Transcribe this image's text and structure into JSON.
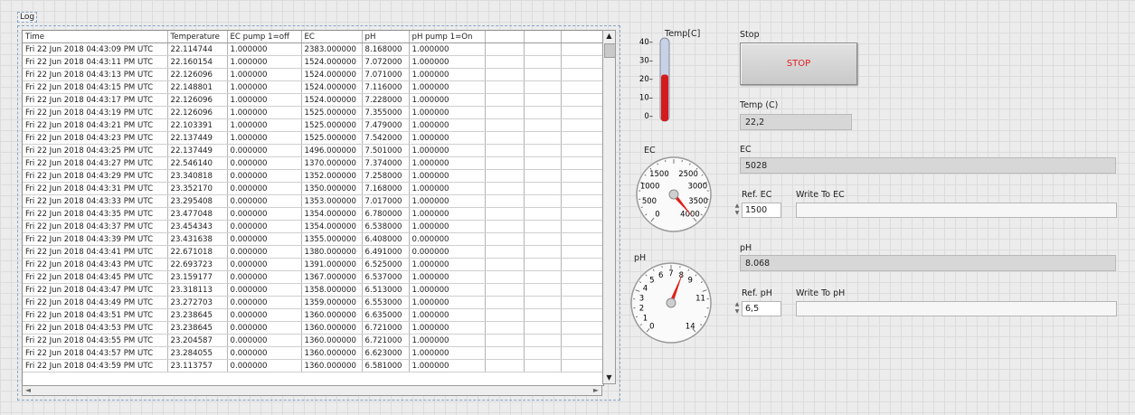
{
  "log": {
    "label": "Log",
    "columns": [
      "Time",
      "Temperature",
      "EC pump 1=off",
      "EC",
      "pH",
      "pH pump 1=On",
      "",
      "",
      ""
    ],
    "rows": [
      [
        "Fri 22 Jun 2018 04:43:09 PM UTC",
        "22.114744",
        "1.000000",
        "2383.000000",
        "8.168000",
        "1.000000"
      ],
      [
        "Fri 22 Jun 2018 04:43:11 PM UTC",
        "22.160154",
        "1.000000",
        "1524.000000",
        "7.072000",
        "1.000000"
      ],
      [
        "Fri 22 Jun 2018 04:43:13 PM UTC",
        "22.126096",
        "1.000000",
        "1524.000000",
        "7.071000",
        "1.000000"
      ],
      [
        "Fri 22 Jun 2018 04:43:15 PM UTC",
        "22.148801",
        "1.000000",
        "1524.000000",
        "7.116000",
        "1.000000"
      ],
      [
        "Fri 22 Jun 2018 04:43:17 PM UTC",
        "22.126096",
        "1.000000",
        "1524.000000",
        "7.228000",
        "1.000000"
      ],
      [
        "Fri 22 Jun 2018 04:43:19 PM UTC",
        "22.126096",
        "1.000000",
        "1525.000000",
        "7.355000",
        "1.000000"
      ],
      [
        "Fri 22 Jun 2018 04:43:21 PM UTC",
        "22.103391",
        "1.000000",
        "1525.000000",
        "7.479000",
        "1.000000"
      ],
      [
        "Fri 22 Jun 2018 04:43:23 PM UTC",
        "22.137449",
        "1.000000",
        "1525.000000",
        "7.542000",
        "1.000000"
      ],
      [
        "Fri 22 Jun 2018 04:43:25 PM UTC",
        "22.137449",
        "0.000000",
        "1496.000000",
        "7.501000",
        "1.000000"
      ],
      [
        "Fri 22 Jun 2018 04:43:27 PM UTC",
        "22.546140",
        "0.000000",
        "1370.000000",
        "7.374000",
        "1.000000"
      ],
      [
        "Fri 22 Jun 2018 04:43:29 PM UTC",
        "23.340818",
        "0.000000",
        "1352.000000",
        "7.258000",
        "1.000000"
      ],
      [
        "Fri 22 Jun 2018 04:43:31 PM UTC",
        "23.352170",
        "0.000000",
        "1350.000000",
        "7.168000",
        "1.000000"
      ],
      [
        "Fri 22 Jun 2018 04:43:33 PM UTC",
        "23.295408",
        "0.000000",
        "1353.000000",
        "7.017000",
        "1.000000"
      ],
      [
        "Fri 22 Jun 2018 04:43:35 PM UTC",
        "23.477048",
        "0.000000",
        "1354.000000",
        "6.780000",
        "1.000000"
      ],
      [
        "Fri 22 Jun 2018 04:43:37 PM UTC",
        "23.454343",
        "0.000000",
        "1354.000000",
        "6.538000",
        "1.000000"
      ],
      [
        "Fri 22 Jun 2018 04:43:39 PM UTC",
        "23.431638",
        "0.000000",
        "1355.000000",
        "6.408000",
        "0.000000"
      ],
      [
        "Fri 22 Jun 2018 04:43:41 PM UTC",
        "22.671018",
        "0.000000",
        "1380.000000",
        "6.491000",
        "0.000000"
      ],
      [
        "Fri 22 Jun 2018 04:43:43 PM UTC",
        "22.693723",
        "0.000000",
        "1391.000000",
        "6.525000",
        "1.000000"
      ],
      [
        "Fri 22 Jun 2018 04:43:45 PM UTC",
        "23.159177",
        "0.000000",
        "1367.000000",
        "6.537000",
        "1.000000"
      ],
      [
        "Fri 22 Jun 2018 04:43:47 PM UTC",
        "23.318113",
        "0.000000",
        "1358.000000",
        "6.513000",
        "1.000000"
      ],
      [
        "Fri 22 Jun 2018 04:43:49 PM UTC",
        "23.272703",
        "0.000000",
        "1359.000000",
        "6.553000",
        "1.000000"
      ],
      [
        "Fri 22 Jun 2018 04:43:51 PM UTC",
        "23.238645",
        "0.000000",
        "1360.000000",
        "6.635000",
        "1.000000"
      ],
      [
        "Fri 22 Jun 2018 04:43:53 PM UTC",
        "23.238645",
        "0.000000",
        "1360.000000",
        "6.721000",
        "1.000000"
      ],
      [
        "Fri 22 Jun 2018 04:43:55 PM UTC",
        "23.204587",
        "0.000000",
        "1360.000000",
        "6.721000",
        "1.000000"
      ],
      [
        "Fri 22 Jun 2018 04:43:57 PM UTC",
        "23.284055",
        "0.000000",
        "1360.000000",
        "6.623000",
        "1.000000"
      ],
      [
        "Fri 22 Jun 2018 04:43:59 PM UTC",
        "23.113757",
        "0.000000",
        "1360.000000",
        "6.581000",
        "1.000000"
      ]
    ]
  },
  "thermometer": {
    "label": "Temp[C]",
    "ticks": [
      "40",
      "30",
      "20",
      "10",
      "0"
    ],
    "value": 22.2,
    "max": 40,
    "fill_color": "#d41b1b"
  },
  "stop": {
    "caption": "Stop",
    "button_label": "STOP",
    "text_color": "#e02020"
  },
  "temp_indicator": {
    "label": "Temp (C)",
    "value": "22,2"
  },
  "ec_gauge": {
    "label": "EC",
    "ticks": [
      "0",
      "500",
      "1000",
      "1500",
      "2500",
      "3000",
      "3500",
      "4000"
    ],
    "value": 5028,
    "max": 4000,
    "needle_color": "#e0201a"
  },
  "ec_indicator": {
    "label": "EC",
    "value": "5028"
  },
  "ref_ec": {
    "label": "Ref. EC",
    "value": "1500"
  },
  "write_ec": {
    "label": "Write To EC",
    "value": ""
  },
  "ph_gauge": {
    "label": "pH",
    "ticks": [
      "0",
      "1",
      "2",
      "3",
      "4",
      "5",
      "6",
      "7",
      "8",
      "9",
      "11",
      "14"
    ],
    "value": 8.068,
    "max": 14,
    "needle_color": "#e0201a"
  },
  "ph_indicator": {
    "label": "pH",
    "value": "8.068"
  },
  "ref_ph": {
    "label": "Ref. pH",
    "value": "6,5"
  },
  "write_ph": {
    "label": "Write To pH",
    "value": ""
  }
}
